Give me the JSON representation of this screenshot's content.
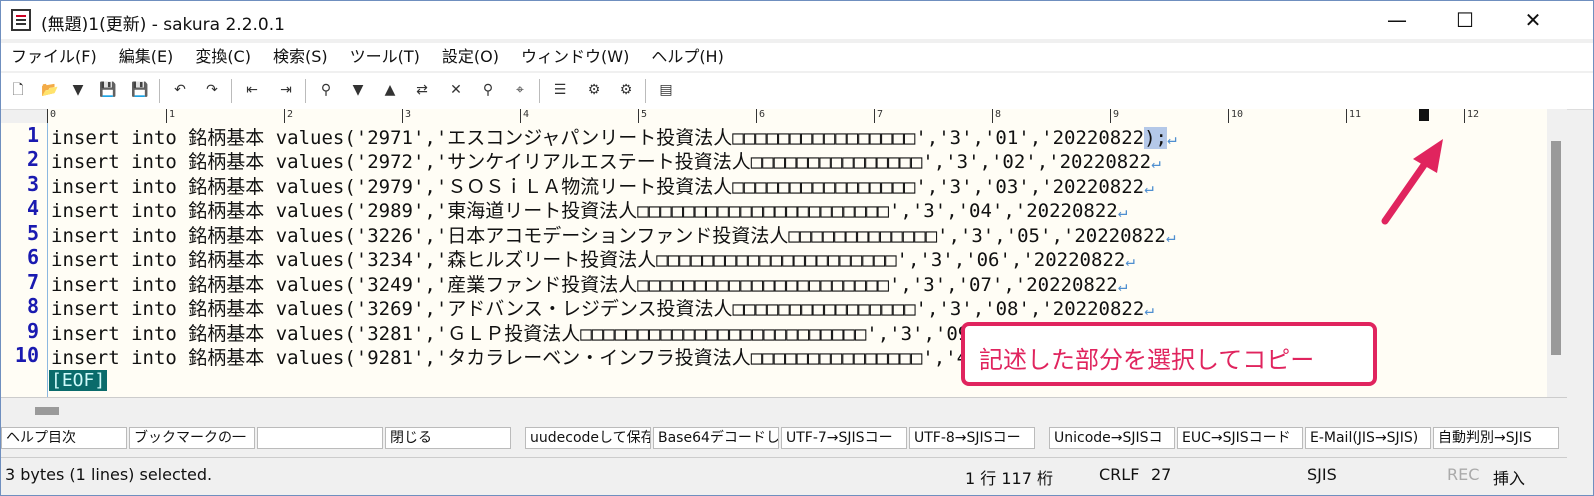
{
  "window": {
    "title": "(無題)1(更新) - sakura 2.2.0.1"
  },
  "window_controls": {
    "minimize": "—",
    "maximize": "☐",
    "close": "✕"
  },
  "menu": [
    "ファイル(F)",
    "編集(E)",
    "変換(C)",
    "検索(S)",
    "ツール(T)",
    "設定(O)",
    "ウィンドウ(W)",
    "ヘルプ(H)"
  ],
  "toolbar_icons": [
    "new-file-icon",
    "open-file-icon",
    "dropdown-icon",
    "save-icon",
    "save-all-icon",
    "undo-icon",
    "redo-icon",
    "jump-prev-icon",
    "jump-next-icon",
    "search-icon",
    "search-prev-icon",
    "search-next-icon",
    "replace-icon",
    "clear-mark-icon",
    "grep-icon",
    "tag-jump-icon",
    "outline-icon",
    "settings-common-icon",
    "settings-type-icon",
    "font-icon",
    "tile-icon"
  ],
  "ruler": {
    "marks": [
      "0",
      "1",
      "2",
      "3",
      "4",
      "5",
      "6",
      "7",
      "8",
      "9",
      "10",
      "11",
      "12"
    ]
  },
  "editor": {
    "lines": [
      {
        "no": "1",
        "text": "insert into 銘柄基本 values('2971','エスコンジャパンリート投資法人□□□□□□□□□□□□□□□□','3','01','20220822",
        "selected": ");"
      },
      {
        "no": "2",
        "text": "insert into 銘柄基本 values('2972','サンケイリアルエステート投資法人□□□□□□□□□□□□□□□','3','02','20220822"
      },
      {
        "no": "3",
        "text": "insert into 銘柄基本 values('2979','ＳＯＳｉＬＡ物流リート投資法人□□□□□□□□□□□□□□□□','3','03','20220822"
      },
      {
        "no": "4",
        "text": "insert into 銘柄基本 values('2989','東海道リート投資法人□□□□□□□□□□□□□□□□□□□□□□','3','04','20220822"
      },
      {
        "no": "5",
        "text": "insert into 銘柄基本 values('3226','日本アコモデーションファンド投資法人□□□□□□□□□□□□□','3','05','20220822"
      },
      {
        "no": "6",
        "text": "insert into 銘柄基本 values('3234','森ヒルズリート投資法人□□□□□□□□□□□□□□□□□□□□□','3','06','20220822"
      },
      {
        "no": "7",
        "text": "insert into 銘柄基本 values('3249','産業ファンド投資法人□□□□□□□□□□□□□□□□□□□□□□','3','07','20220822"
      },
      {
        "no": "8",
        "text": "insert into 銘柄基本 values('3269','アドバンス・レジデンス投資法人□□□□□□□□□□□□□□□□','3','08','20220822"
      },
      {
        "no": "9",
        "text": "insert into 銘柄基本 values('3281','ＧＬＰ投資法人□□□□□□□□□□□□□□□□□□□□□□□□□','3','09','20220822"
      },
      {
        "no": "10",
        "text": "insert into 銘柄基本 values('9281','タカラレーベン・インフラ投資法人□□□□□□□□□□□□□□□','4','00','20220822"
      }
    ],
    "eol_mark": "↵",
    "eof": "[EOF]"
  },
  "callout": {
    "text": "記述した部分を選択してコピー",
    "color": "#e0245e"
  },
  "function_keys": [
    "ヘルプ目次",
    "ブックマークの一",
    "",
    "閉じる",
    "uudecodeして保存",
    "Base64デコードして",
    "UTF-7→SJISコー",
    "UTF-8→SJISコー",
    "Unicode→SJISコ",
    "EUC→SJISコード",
    "E-Mail(JIS→SJIS)",
    "自動判別→SJIS"
  ],
  "statusbar": {
    "message": "3 bytes (1 lines) selected.",
    "position": "1 行 117 桁",
    "eol": "CRLF",
    "char_code": "27",
    "encoding": "SJIS",
    "rec": "REC",
    "mode": "挿入"
  }
}
